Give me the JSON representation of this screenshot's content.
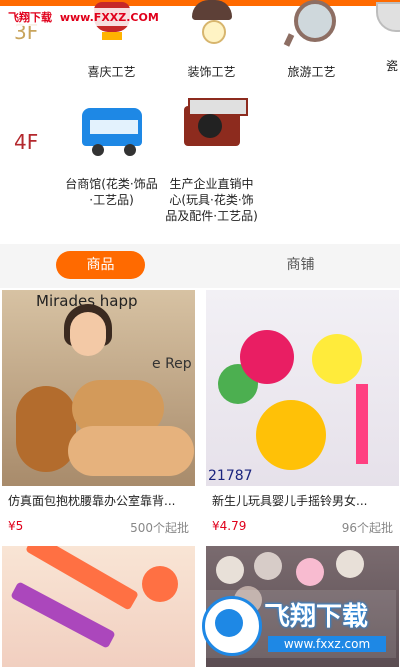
{
  "watermark_top": {
    "brand": "飞翔下载",
    "domain": "www.FXXZ.COM"
  },
  "floors": [
    {
      "label": "3F",
      "categories": [
        {
          "label": "喜庆工艺",
          "icon": "lantern-icon"
        },
        {
          "label": "装饰工艺",
          "icon": "lamp-icon"
        },
        {
          "label": "旅游工艺",
          "icon": "compass-icon"
        },
        {
          "label": "瓷",
          "icon": "bowl-icon"
        }
      ]
    },
    {
      "label": "4F",
      "categories": [
        {
          "label": "台商馆(花类·饰品·工艺品)",
          "icon": "bus-toy-icon"
        },
        {
          "label": "生产企业直销中心(玩具·花类·饰品及配件·工艺品)",
          "icon": "record-player-icon"
        }
      ]
    }
  ],
  "tabs": {
    "items": [
      {
        "label": "商品",
        "active": true
      },
      {
        "label": "商铺",
        "active": false
      }
    ],
    "accent": "#ff6a00"
  },
  "products": [
    {
      "title": "仿真面包抱枕腰靠办公室靠背...",
      "price": "¥5",
      "moq": "500个起批",
      "image_text": "Mirades happ",
      "image_text2": "e Rep"
    },
    {
      "title": "新生儿玩具婴儿手摇铃男女...",
      "price": "¥4.79",
      "moq": "96个起批",
      "image_text": "21787"
    }
  ],
  "watermark_bottom": {
    "brand": "飞翔下载",
    "domain": "www.fxxz.com"
  },
  "colors": {
    "price": "#e0001b",
    "floor_label": "#b4282d"
  }
}
